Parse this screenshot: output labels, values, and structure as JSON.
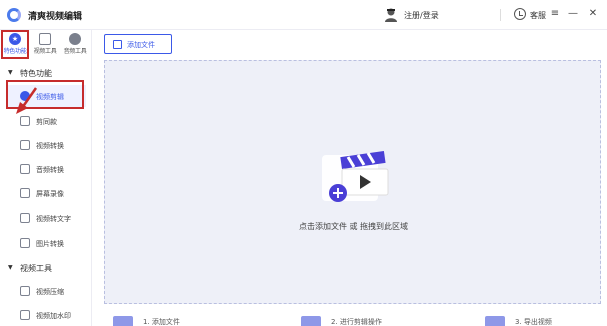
{
  "app": {
    "title": "清爽视频编辑"
  },
  "header": {
    "login": "注册/登录",
    "service": "客服",
    "min": "—",
    "max": "☐",
    "close": "✕"
  },
  "topnav": [
    {
      "label": "特色功能",
      "icon": "star-icon"
    },
    {
      "label": "视频工具",
      "icon": "video-tool-icon"
    },
    {
      "label": "音频工具",
      "icon": "audio-tool-icon"
    }
  ],
  "sidebar": {
    "section1": {
      "title": "特色功能",
      "caret": "▼"
    },
    "section2": {
      "title": "视频工具",
      "caret": "▼"
    },
    "items": [
      {
        "label": "视频剪辑"
      },
      {
        "label": "剪同款"
      },
      {
        "label": "视频转换"
      },
      {
        "label": "音频转换"
      },
      {
        "label": "屏幕录像"
      },
      {
        "label": "视频转文字"
      },
      {
        "label": "图片转换"
      },
      {
        "label": "视频压缩"
      },
      {
        "label": "视频加水印"
      }
    ]
  },
  "main": {
    "add_button": "添加文件",
    "drop_text": "点击添加文件 或 拖拽到此区域",
    "steps": [
      "1. 添加文件",
      "2. 进行剪辑操作",
      "3. 导出视频"
    ]
  },
  "colors": {
    "accent": "#3b59e8",
    "highlight": "#c62c2c",
    "dropzone": "#eef0f8"
  }
}
